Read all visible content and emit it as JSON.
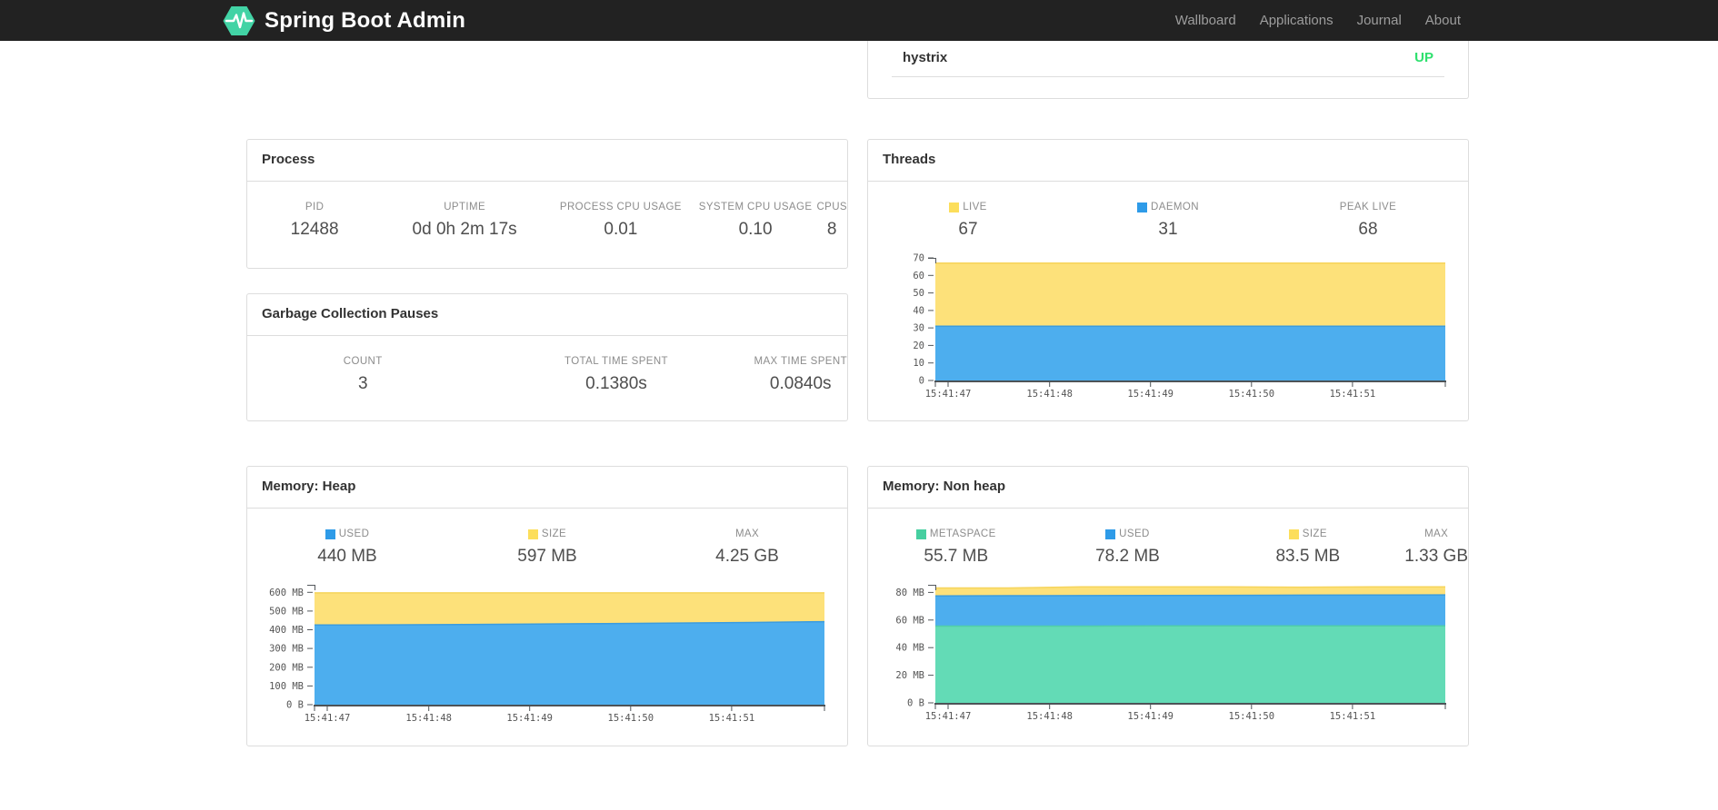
{
  "navbar": {
    "brand": "Spring Boot Admin",
    "logo_icon": "pulse-hexagon-icon",
    "logo_color": "#42d3a5",
    "links": [
      "Wallboard",
      "Applications",
      "Journal",
      "About"
    ]
  },
  "status_card": {
    "application": "hystrix",
    "status": "UP",
    "status_color": "#2ee06e"
  },
  "cards": {
    "process": {
      "title": "Process",
      "metrics": [
        {
          "label": "PID",
          "value": "12488"
        },
        {
          "label": "UPTIME",
          "value": "0d 0h 2m 17s"
        },
        {
          "label": "PROCESS CPU USAGE",
          "value": "0.01"
        },
        {
          "label": "SYSTEM CPU USAGE",
          "value": "0.10"
        },
        {
          "label": "CPUS",
          "value": "8"
        }
      ]
    },
    "gc": {
      "title": "Garbage Collection Pauses",
      "metrics": [
        {
          "label": "COUNT",
          "value": "3"
        },
        {
          "label": "TOTAL TIME SPENT",
          "value": "0.1380s"
        },
        {
          "label": "MAX TIME SPENT",
          "value": "0.0840s"
        }
      ]
    },
    "threads": {
      "title": "Threads",
      "metrics": [
        {
          "label": "LIVE",
          "value": "67",
          "swatch": "#fcde5b"
        },
        {
          "label": "DAEMON",
          "value": "31",
          "swatch": "#2e9be8"
        },
        {
          "label": "PEAK LIVE",
          "value": "68"
        }
      ]
    },
    "heap": {
      "title": "Memory: Heap",
      "metrics": [
        {
          "label": "USED",
          "value": "440 MB",
          "swatch": "#2e9be8"
        },
        {
          "label": "SIZE",
          "value": "597 MB",
          "swatch": "#fcde5b"
        },
        {
          "label": "MAX",
          "value": "4.25 GB"
        }
      ]
    },
    "nonheap": {
      "title": "Memory: Non heap",
      "metrics": [
        {
          "label": "METASPACE",
          "value": "55.7 MB",
          "swatch": "#46cfa0"
        },
        {
          "label": "USED",
          "value": "78.2 MB",
          "swatch": "#2e9be8"
        },
        {
          "label": "SIZE",
          "value": "83.5 MB",
          "swatch": "#fcde5b"
        },
        {
          "label": "MAX",
          "value": "1.33 GB"
        }
      ]
    }
  },
  "chart_data": [
    {
      "name": "threads",
      "title": "Threads",
      "type": "area",
      "stacked": false,
      "grid": false,
      "x_labels": [
        "15:41:47",
        "15:41:48",
        "15:41:49",
        "15:41:50",
        "15:41:51"
      ],
      "x_label_fracs": [
        0.025,
        0.224,
        0.422,
        0.62,
        0.818
      ],
      "ylim": [
        0,
        70
      ],
      "y_ticks": [
        {
          "v": 0,
          "label": "0"
        },
        {
          "v": 10,
          "label": "10"
        },
        {
          "v": 20,
          "label": "20"
        },
        {
          "v": 30,
          "label": "30"
        },
        {
          "v": 40,
          "label": "40"
        },
        {
          "v": 50,
          "label": "50"
        },
        {
          "v": 60,
          "label": "60"
        },
        {
          "v": 70,
          "label": "70"
        }
      ],
      "series": [
        {
          "name": "live",
          "color": "#fde17a",
          "stroke": "#f6d45b",
          "values": [
            67,
            67,
            67,
            67,
            67,
            67,
            67,
            67
          ]
        },
        {
          "name": "daemon",
          "color": "#4daeee",
          "stroke": "#3b9cdf",
          "values": [
            31,
            31,
            31,
            31,
            31,
            31,
            31,
            31
          ]
        }
      ]
    },
    {
      "name": "heap",
      "title": "Memory: Heap",
      "type": "area",
      "stacked": false,
      "grid": false,
      "x_labels": [
        "15:41:47",
        "15:41:48",
        "15:41:49",
        "15:41:50",
        "15:41:51"
      ],
      "x_label_fracs": [
        0.025,
        0.224,
        0.422,
        0.62,
        0.818
      ],
      "ylim": [
        0,
        640
      ],
      "unit": "MB",
      "y_ticks": [
        {
          "v": 0,
          "label": "0 B"
        },
        {
          "v": 100,
          "label": "100 MB"
        },
        {
          "v": 200,
          "label": "200 MB"
        },
        {
          "v": 300,
          "label": "300 MB"
        },
        {
          "v": 400,
          "label": "400 MB"
        },
        {
          "v": 500,
          "label": "500 MB"
        },
        {
          "v": 600,
          "label": "600 MB"
        }
      ],
      "series": [
        {
          "name": "size",
          "color": "#fde17a",
          "stroke": "#f6d45b",
          "values": [
            597,
            597,
            597,
            597,
            597,
            597,
            597,
            597
          ]
        },
        {
          "name": "used",
          "color": "#4daeee",
          "stroke": "#3b9cdf",
          "values": [
            425,
            426,
            428,
            430,
            433,
            436,
            439,
            443
          ]
        }
      ]
    },
    {
      "name": "nonheap",
      "title": "Memory: Non heap",
      "type": "area",
      "stacked": false,
      "grid": false,
      "x_labels": [
        "15:41:47",
        "15:41:48",
        "15:41:49",
        "15:41:50",
        "15:41:51"
      ],
      "x_label_fracs": [
        0.025,
        0.224,
        0.422,
        0.62,
        0.818
      ],
      "ylim": [
        0,
        85.5
      ],
      "unit": "MB",
      "y_ticks": [
        {
          "v": 0,
          "label": "0 B"
        },
        {
          "v": 20,
          "label": "20 MB"
        },
        {
          "v": 40,
          "label": "40 MB"
        },
        {
          "v": 60,
          "label": "60 MB"
        },
        {
          "v": 80,
          "label": "80 MB"
        }
      ],
      "series": [
        {
          "name": "size",
          "color": "#fde17a",
          "stroke": "#f6d45b",
          "values": [
            83.2,
            83.2,
            84,
            84,
            84,
            83.8,
            84,
            84
          ]
        },
        {
          "name": "used",
          "color": "#4daeee",
          "stroke": "#3b9cdf",
          "values": [
            77.5,
            77.6,
            77.7,
            77.8,
            77.9,
            78,
            78.1,
            78.2
          ]
        },
        {
          "name": "metaspace",
          "color": "#63dbb6",
          "stroke": "#50cfa7",
          "values": [
            55.6,
            55.6,
            55.6,
            55.7,
            55.7,
            55.7,
            55.7,
            55.7
          ]
        }
      ]
    }
  ]
}
